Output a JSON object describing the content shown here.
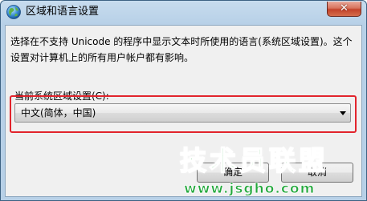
{
  "window": {
    "title": "区域和语言设置",
    "close_label": "✕"
  },
  "description": "选择在不支持 Unicode 的程序中显示文本时所使用的语言(系统区域设置)。这个设置对计算机上的所有用户帐户都有影响。",
  "locale": {
    "label": "当前系统区域设置(C):",
    "selected_value": "中文(简体，中国)"
  },
  "buttons": {
    "ok_label": "确定",
    "cancel_label": "取消"
  },
  "watermark": {
    "title": "技术员联盟",
    "url": "www.jsgho.com"
  },
  "colors": {
    "highlight_border": "#e2242c",
    "watermark_green": "#22a83b",
    "close_red": "#c3432b"
  },
  "icons": {
    "title": "globe-icon",
    "dropdown": "chevron-down-icon"
  }
}
